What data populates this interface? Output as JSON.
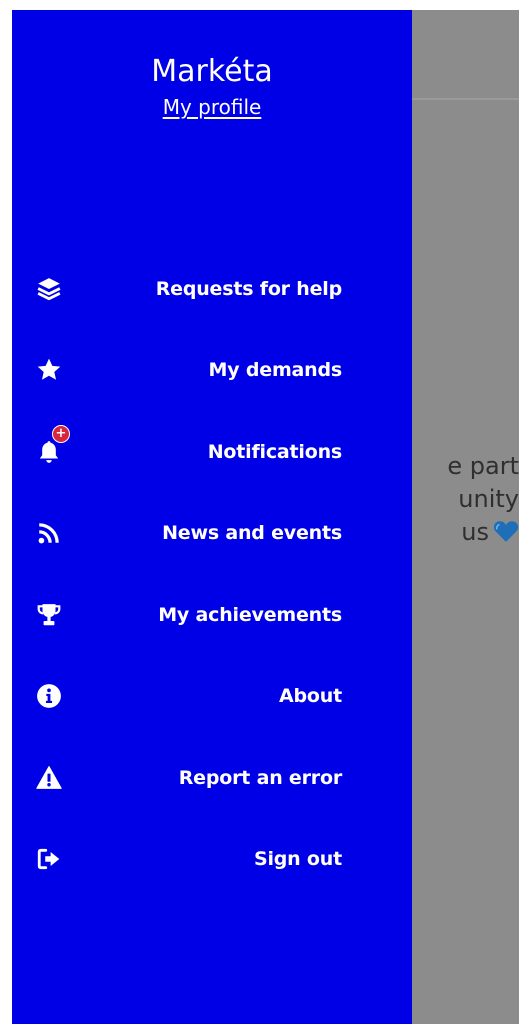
{
  "drawer": {
    "user_name": "Markéta",
    "profile_link": "My profile",
    "background_color": "#0000e6",
    "items": [
      {
        "label": "Requests for help",
        "icon": "layers-icon"
      },
      {
        "label": "My demands",
        "icon": "star-icon"
      },
      {
        "label": "Notifications",
        "icon": "bell-icon",
        "badge": "+"
      },
      {
        "label": "News and events",
        "icon": "rss-icon"
      },
      {
        "label": "My achievements",
        "icon": "trophy-icon"
      },
      {
        "label": "About",
        "icon": "info-icon"
      },
      {
        "label": "Report an error",
        "icon": "warning-icon"
      },
      {
        "label": "Sign out",
        "icon": "sign-out-icon"
      }
    ]
  },
  "background_content": {
    "lines": [
      "e part",
      "unity",
      "us"
    ],
    "emoji": "blue-heart-icon"
  }
}
